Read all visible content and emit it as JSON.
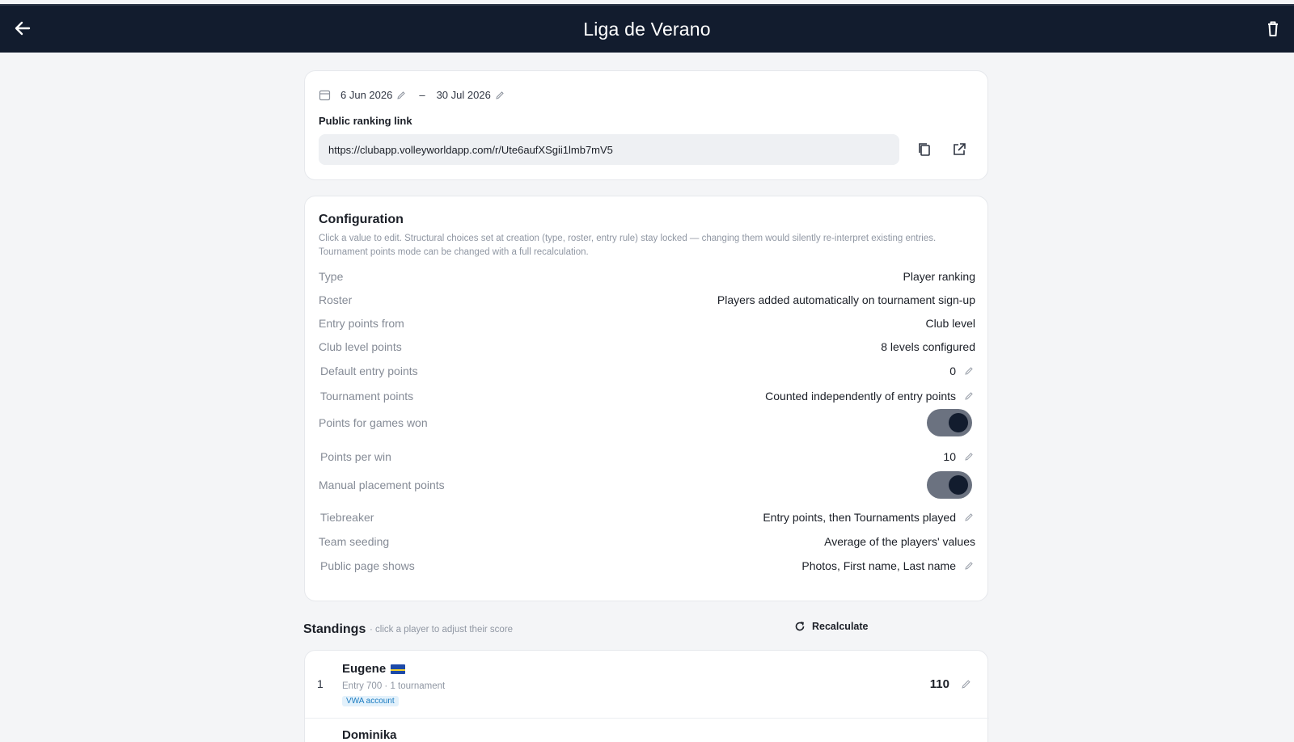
{
  "header": {
    "title": "Liga de Verano",
    "back_icon": "arrow-left-icon",
    "delete_icon": "trash-icon"
  },
  "dates": {
    "start": "6 Jun 2026",
    "separator": "–",
    "end": "30 Jul 2026"
  },
  "public_link": {
    "label": "Public ranking link",
    "url": "https://clubapp.volleyworldapp.com/r/Ute6aufXSgii1lmb7mV5"
  },
  "configuration": {
    "title": "Configuration",
    "description": "Click a value to edit. Structural choices set at creation (type, roster, entry rule) stay locked — changing them would silently re-interpret existing entries. Tournament points mode can be changed with a full recalculation.",
    "rows": [
      {
        "label": "Type",
        "value": "Player ranking"
      },
      {
        "label": "Roster",
        "value": "Players added automatically on tournament sign-up"
      },
      {
        "label": "Entry points from",
        "value": "Club level"
      },
      {
        "label": "Club level points",
        "value": "8 levels configured"
      },
      {
        "label": "Default entry points",
        "value": "0"
      },
      {
        "label": "Tournament points",
        "value": "Counted independently of entry points"
      },
      {
        "label": "Points for games won",
        "toggle": true
      },
      {
        "label": "Points per win",
        "value": "10"
      },
      {
        "label": "Manual placement points",
        "toggle": true
      },
      {
        "label": "Tiebreaker",
        "value": "Entry points, then Tournaments played"
      },
      {
        "label": "Team seeding",
        "value": "Average of the players' values"
      },
      {
        "label": "Public page shows",
        "value": "Photos, First name, Last name"
      }
    ]
  },
  "standings": {
    "title": "Standings",
    "hint": "· click a player to adjust their score",
    "recalculate_label": "Recalculate",
    "players": [
      {
        "rank": "1",
        "name": "Eugene",
        "meta": "Entry 700 · 1 tournament",
        "badge": "VWA account",
        "score": "110"
      },
      {
        "name": "Dominika"
      }
    ]
  },
  "colors": {
    "appbar": "#121c2e",
    "toggle_track": "#6b7280",
    "badge_text": "#1a7bc0"
  }
}
